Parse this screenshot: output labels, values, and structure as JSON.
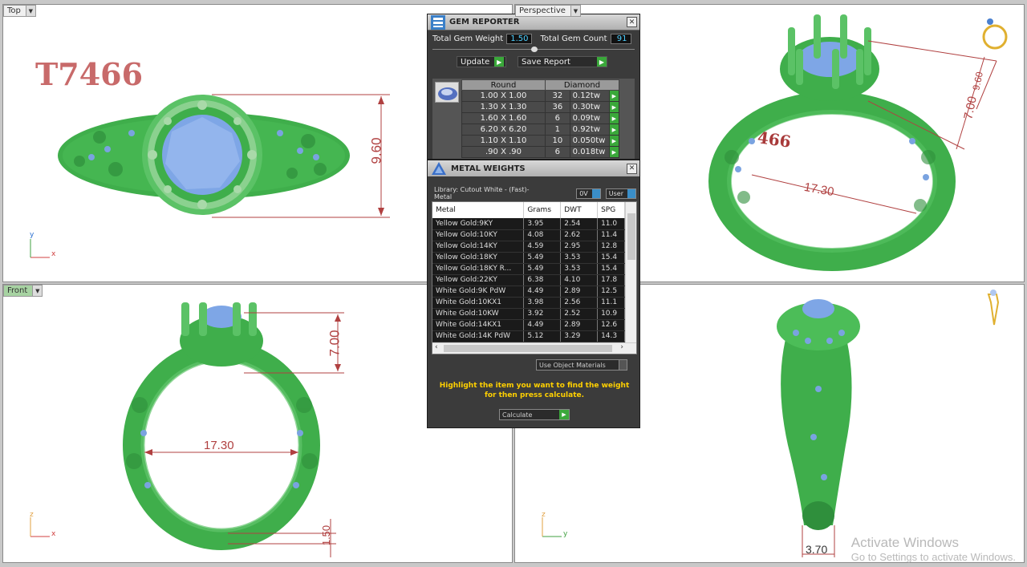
{
  "viewports": {
    "top": {
      "label": "Top",
      "stamp": "T7466",
      "dims": [
        "9.60"
      ],
      "axes": [
        "y",
        "x"
      ]
    },
    "perspective": {
      "label": "Perspective",
      "stamp": "466",
      "dims": [
        "17.30",
        "7.00",
        "9.60"
      ]
    },
    "front": {
      "label": "Front",
      "dims": [
        "7.00",
        "17.30",
        "1.50"
      ],
      "axes": [
        "z",
        "x"
      ]
    },
    "right": {
      "dims": [
        "3.70"
      ],
      "axes": [
        "z",
        "y"
      ]
    }
  },
  "gem_reporter": {
    "title": "GEM REPORTER",
    "total_weight_label": "Total Gem Weight",
    "total_weight": "1.50",
    "total_count_label": "Total Gem Count",
    "total_count": "91",
    "update_label": "Update",
    "save_label": "Save Report",
    "headers": [
      "Round",
      "Diamond"
    ],
    "rows": [
      {
        "size": "1.00 X 1.00",
        "count": "32",
        "tw": "0.12tw"
      },
      {
        "size": "1.30 X 1.30",
        "count": "36",
        "tw": "0.30tw"
      },
      {
        "size": "1.60 X 1.60",
        "count": "6",
        "tw": "0.09tw"
      },
      {
        "size": "6.20 X 6.20",
        "count": "1",
        "tw": "0.92tw"
      },
      {
        "size": "1.10 X 1.10",
        "count": "10",
        "tw": "0.050tw"
      },
      {
        "size": ".90 X .90",
        "count": "6",
        "tw": "0.018tw"
      }
    ]
  },
  "metal_weights": {
    "title": "METAL WEIGHTS",
    "library": "Library: Cutout White - (Fast)-Metal",
    "chip1": "0V",
    "chip2": "User",
    "headers": [
      "Metal",
      "Grams",
      "DWT",
      "SPG"
    ],
    "rows": [
      [
        "Yellow Gold:9KY",
        "3.95",
        "2.54",
        "11.0"
      ],
      [
        "Yellow Gold:10KY",
        "4.08",
        "2.62",
        "11.4"
      ],
      [
        "Yellow Gold:14KY",
        "4.59",
        "2.95",
        "12.8"
      ],
      [
        "Yellow Gold:18KY",
        "5.49",
        "3.53",
        "15.4"
      ],
      [
        "Yellow Gold:18KY R...",
        "5.49",
        "3.53",
        "15.4"
      ],
      [
        "Yellow Gold:22KY",
        "6.38",
        "4.10",
        "17.8"
      ],
      [
        "White Gold:9K PdW",
        "4.49",
        "2.89",
        "12.5"
      ],
      [
        "White Gold:10KX1",
        "3.98",
        "2.56",
        "11.1"
      ],
      [
        "White Gold:10KW",
        "3.92",
        "2.52",
        "10.9"
      ],
      [
        "White Gold:14KX1",
        "4.49",
        "2.89",
        "12.6"
      ],
      [
        "White Gold:14K PdW",
        "5.12",
        "3.29",
        "14.3"
      ]
    ],
    "use_object_materials": "Use Object Materials",
    "hint": "Highlight the item you want to find the weight for then press calculate.",
    "calculate_label": "Calculate"
  },
  "watermark": {
    "title": "Activate Windows",
    "subtitle": "Go to Settings to activate Windows."
  },
  "colors": {
    "metal": "#3fae4b",
    "gem": "#6f95d9",
    "dim": "#b04040",
    "accent": "#3aa83a"
  }
}
